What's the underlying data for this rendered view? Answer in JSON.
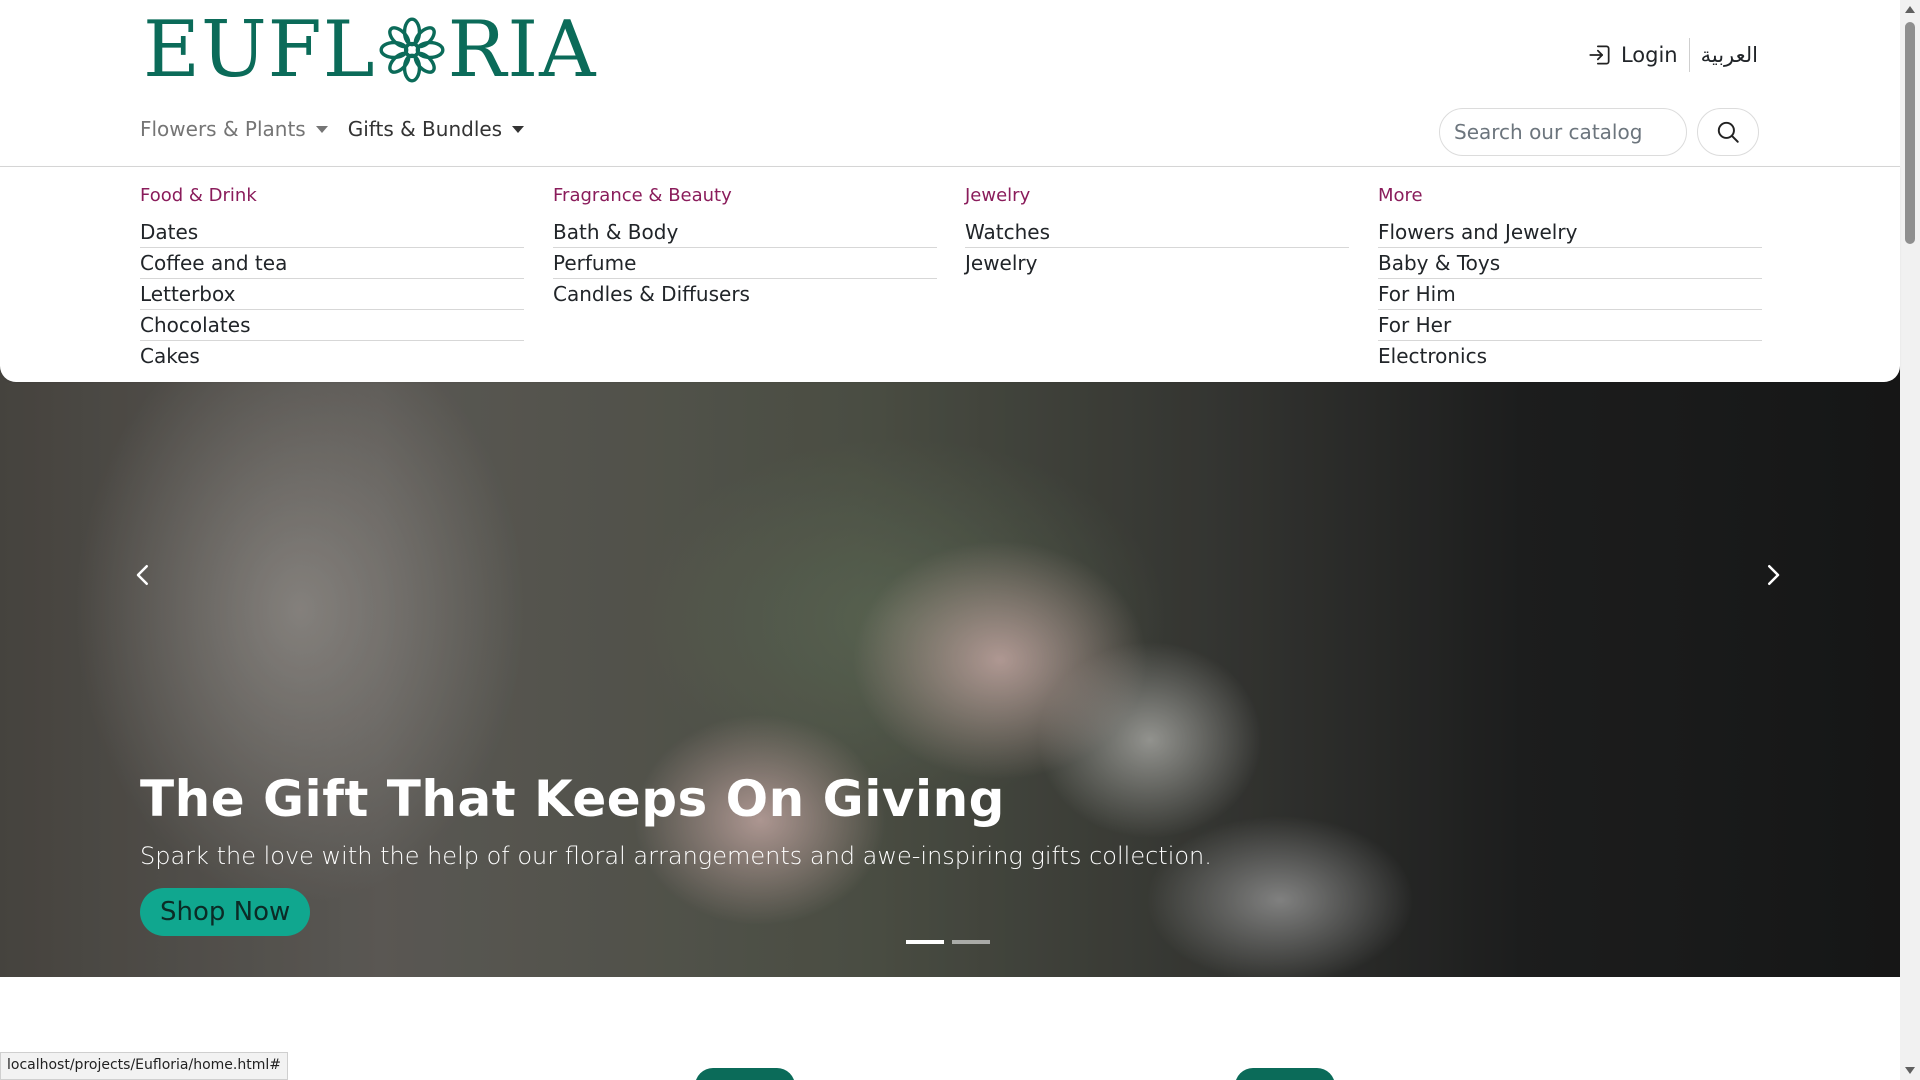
{
  "brand": {
    "logo_text_left": "EUFL",
    "logo_text_right": "RIA",
    "logo_icon": "flower-mandala-icon",
    "brand_color": "#0b6b59"
  },
  "header": {
    "login_label": "Login",
    "login_icon": "sign-in-icon",
    "language_label": "العربية"
  },
  "nav": [
    {
      "label": "Flowers & Plants"
    },
    {
      "label": "Gifts & Bundles"
    }
  ],
  "search": {
    "placeholder": "Search our catalog",
    "icon": "search-icon"
  },
  "mega_menu": {
    "accent_color": "#8a1c5b",
    "columns": [
      {
        "title": "Food & Drink",
        "items": [
          "Dates",
          "Coffee and tea",
          "Letterbox",
          "Chocolates",
          "Cakes"
        ]
      },
      {
        "title": "Fragrance & Beauty",
        "items": [
          "Bath & Body",
          "Perfume",
          "Candles & Diffusers"
        ]
      },
      {
        "title": "Jewelry",
        "items": [
          "Watches",
          "Jewelry"
        ]
      },
      {
        "title": "More",
        "items": [
          "Flowers and Jewelry",
          "Baby & Toys",
          "For Him",
          "For Her",
          "Electronics"
        ]
      }
    ]
  },
  "hero": {
    "title": "The Gift That Keeps On Giving",
    "subtitle": "Spark the love with the help of our floral arrangements and awe-inspiring gifts collection.",
    "cta_label": "Shop Now",
    "cta_color": "#10a78f",
    "slide_count": 2,
    "active_slide": 1
  },
  "status_bar": {
    "url": "localhost/projects/Eufloria/home.html#"
  }
}
